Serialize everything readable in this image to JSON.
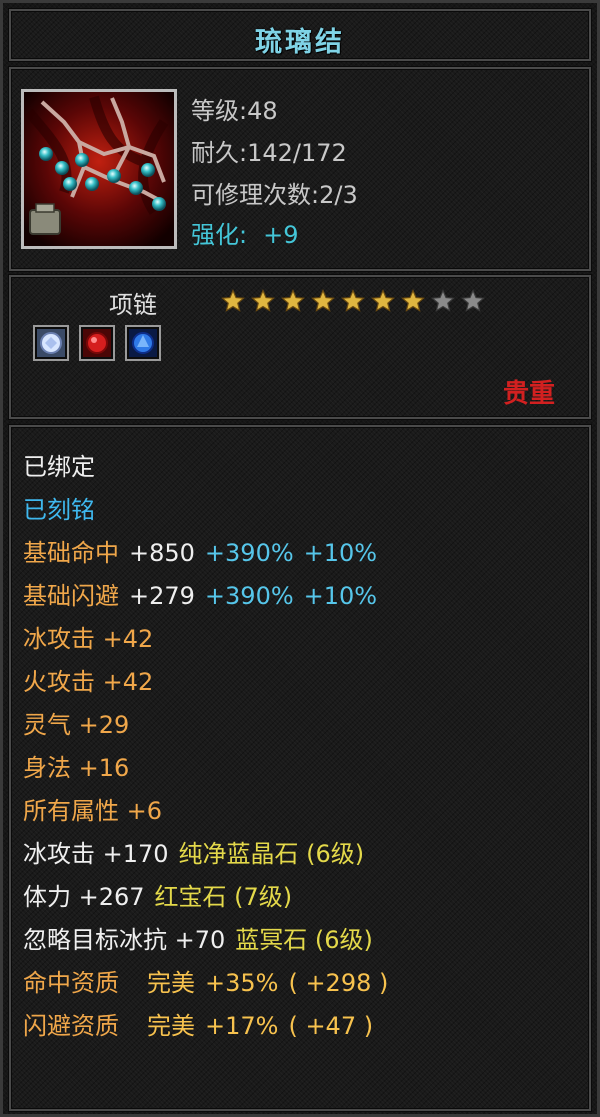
{
  "item": {
    "name": "琉璃结",
    "level": "等级:48",
    "durability": "耐久:142/172",
    "repair_count": "可修理次数:2/3",
    "enhance_label": "强化:",
    "enhance_value": "+9",
    "type": "项链",
    "stars_filled": 7,
    "stars_total": 9,
    "quality": "贵重",
    "gems": [
      "white-gem-icon",
      "red-gem-icon",
      "blue-gem-icon"
    ]
  },
  "attributes": {
    "bound": "已绑定",
    "engraved": "已刻铭",
    "hit": {
      "name": "基础命中",
      "base": "+850",
      "pct1": "+390%",
      "pct2": "+10%"
    },
    "dodge": {
      "name": "基础闪避",
      "base": "+279",
      "pct1": "+390%",
      "pct2": "+10%"
    },
    "ice_attack": "冰攻击 +42",
    "fire_attack": "火攻击 +42",
    "spirit": "灵气 +29",
    "agility": "身法 +16",
    "all_attr": "所有属性 +6",
    "gem1": {
      "stat": "冰攻击 +170",
      "gem": "纯净蓝晶石 (6级)"
    },
    "gem2": {
      "stat": "体力 +267",
      "gem": "红宝石 (7级)"
    },
    "gem3": {
      "stat": "忽略目标冰抗 +70",
      "gem": "蓝冥石 (6级)"
    },
    "hit_aptitude": {
      "name": "命中资质",
      "grade": "完美",
      "pct": "+35%",
      "val": "( +298 )"
    },
    "dodge_aptitude": {
      "name": "闪避资质",
      "grade": "完美",
      "pct": "+17%",
      "val": "( +47 )"
    }
  },
  "colors": {
    "title": "#7fd3e6",
    "enhance": "#44c6d8",
    "quality": "#d22020",
    "engraved": "#3fb8ee",
    "attribute": "#f0a74a",
    "gem_stat": "#e4d94a",
    "star_filled": "#e0b640",
    "star_empty": "#8a8a8a"
  }
}
